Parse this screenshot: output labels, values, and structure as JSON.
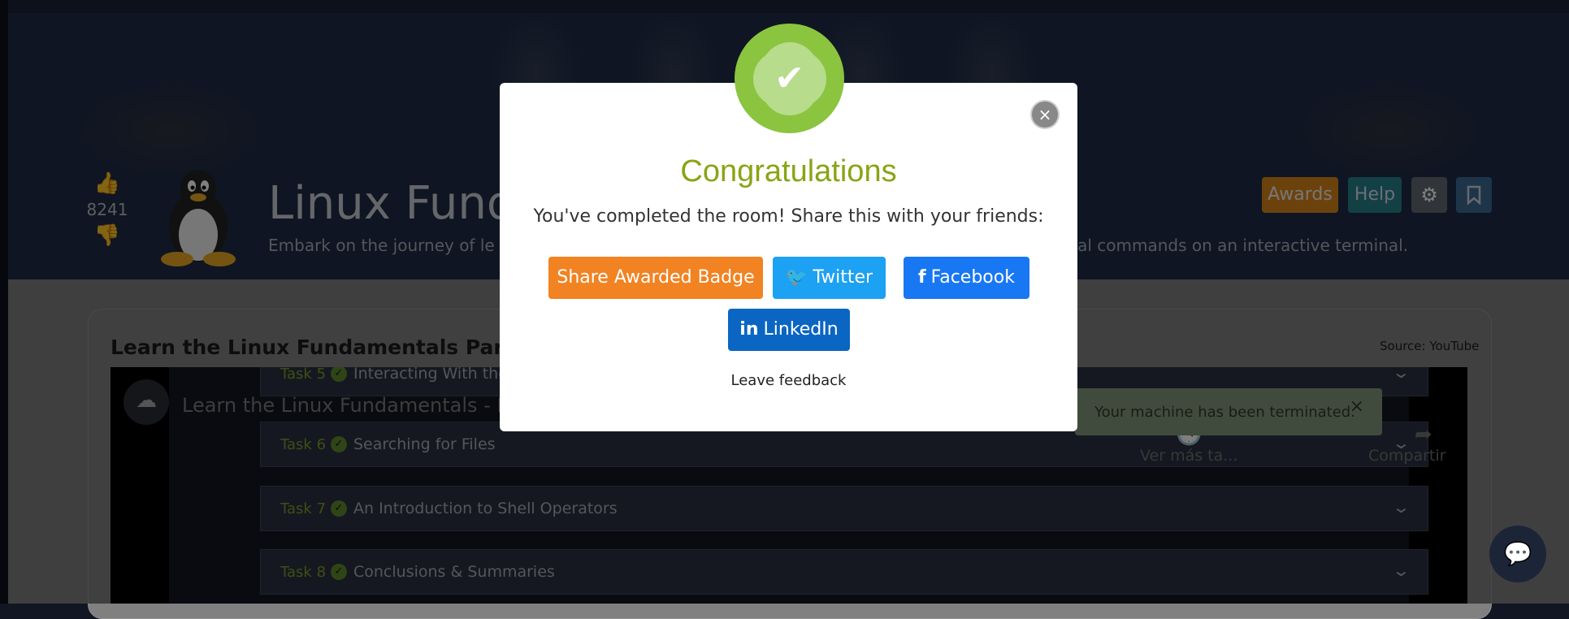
{
  "room": {
    "vote_count": "8241",
    "title": "Linux Fund",
    "description_left": "Embark on the journey of le",
    "description_right": "ntial commands on an interactive terminal."
  },
  "header_buttons": {
    "awards": "Awards",
    "help": "Help",
    "settings_icon": "gear-icon",
    "bookmark_icon": "bookmark-icon"
  },
  "video_card": {
    "title": "Learn the Linux Fundamentals Part 1 | T",
    "source": "Source: YouTube",
    "video_title": "Learn the Linux Fundamentals - Pa",
    "watch_later": "Ver más ta...",
    "share": "Compartir",
    "tasks": [
      {
        "number": "Task 5",
        "title": "Interacting With the Filesyste"
      },
      {
        "number": "Task 6",
        "title": "Searching for Files"
      },
      {
        "number": "Task 7",
        "title": "An Introduction to Shell Operators"
      },
      {
        "number": "Task 8",
        "title": "Conclusions & Summaries"
      }
    ]
  },
  "toast": {
    "message": "Your machine has been terminated.",
    "close": "×"
  },
  "modal": {
    "heading": "Congratulations",
    "message": "You've completed the room! Share this with your friends:",
    "share_badge": "Share Awarded Badge",
    "twitter": "Twitter",
    "facebook": "Facebook",
    "linkedin": "LinkedIn",
    "feedback": "Leave feedback",
    "close": "×",
    "accent_color": "#88a515"
  }
}
